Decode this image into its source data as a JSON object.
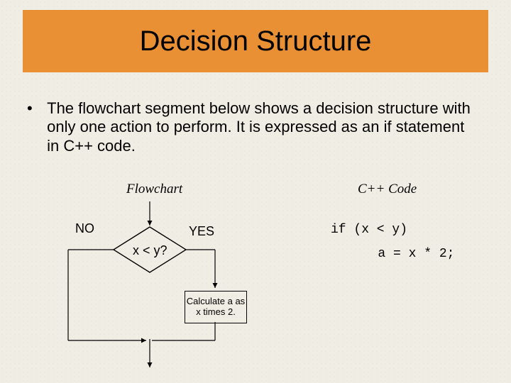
{
  "title": "Decision Structure",
  "bullet": "The flowchart segment below shows a decision structure with only one action to perform. It is expressed as an if statement in C++ code.",
  "columns": {
    "flowchart": "Flowchart",
    "code": "C++ Code"
  },
  "flowchart": {
    "no": "NO",
    "yes": "YES",
    "decision": "x < y?",
    "action": "Calculate a as x times 2."
  },
  "code": {
    "line1": "if (x < y)",
    "line2": "   a = x * 2;"
  }
}
